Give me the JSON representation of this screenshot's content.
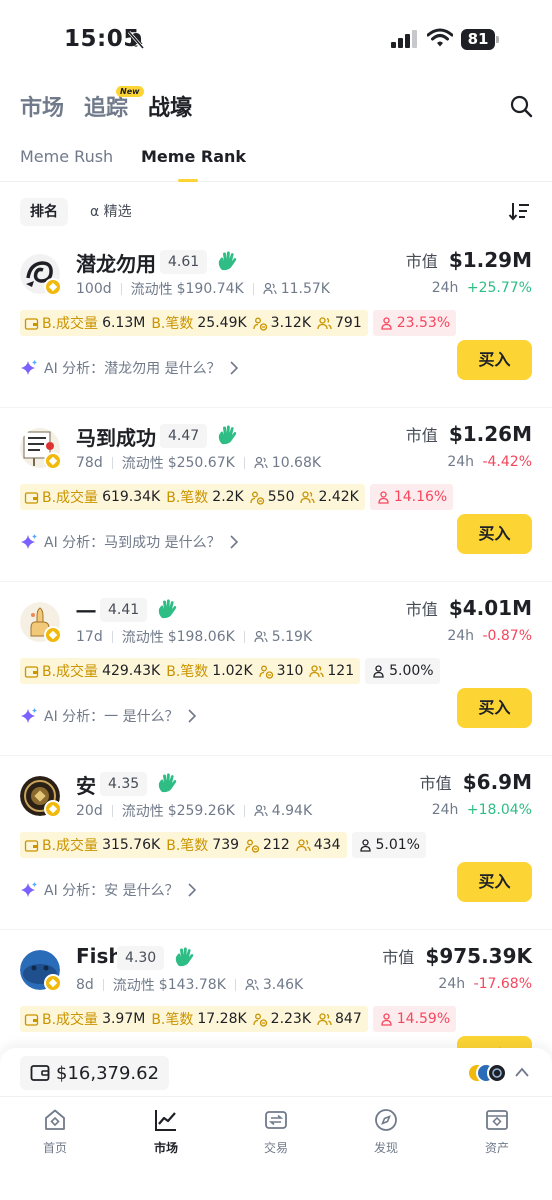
{
  "status_bar": {
    "time": "15:05",
    "battery": "81"
  },
  "top_tabs": [
    {
      "label": "市场",
      "active": false
    },
    {
      "label": "追踪",
      "active": false,
      "badge": "New"
    },
    {
      "label": "战壕",
      "active": true
    }
  ],
  "sub_tabs": [
    {
      "label": "Meme Rush",
      "active": false
    },
    {
      "label": "Meme Rank",
      "active": true
    }
  ],
  "filters": {
    "rank": "排名",
    "alpha": "α 精选"
  },
  "labels": {
    "market_cap": "市值",
    "change_period": "24h",
    "liquidity": "流动性",
    "b_volume": "B.成交量",
    "b_count": "B.笔数",
    "buy": "买入"
  },
  "tokens": [
    {
      "name": "潜龙勿用",
      "score": "4.61",
      "age": "100d",
      "liquidity": "$190.74K",
      "holders": "11.57K",
      "market_cap": "$1.29M",
      "change": "+25.77%",
      "direction": "up",
      "b_volume": "6.13M",
      "b_count": "25.49K",
      "stat3": "3.12K",
      "stat4": "791",
      "pct": "23.53%",
      "pct_style": "red",
      "ai": "AI 分析：潜龙勿用 是什么？"
    },
    {
      "name": "马到成功",
      "score": "4.47",
      "age": "78d",
      "liquidity": "$250.67K",
      "holders": "10.68K",
      "market_cap": "$1.26M",
      "change": "-4.42%",
      "direction": "down",
      "b_volume": "619.34K",
      "b_count": "2.2K",
      "stat3": "550",
      "stat4": "2.42K",
      "pct": "14.16%",
      "pct_style": "red",
      "ai": "AI 分析：马到成功 是什么？"
    },
    {
      "name": "一",
      "score": "4.41",
      "age": "17d",
      "liquidity": "$198.06K",
      "holders": "5.19K",
      "market_cap": "$4.01M",
      "change": "-0.87%",
      "direction": "down",
      "b_volume": "429.43K",
      "b_count": "1.02K",
      "stat3": "310",
      "stat4": "121",
      "pct": "5.00%",
      "pct_style": "gray",
      "ai": "AI 分析：一 是什么？"
    },
    {
      "name": "安",
      "score": "4.35",
      "age": "20d",
      "liquidity": "$259.26K",
      "holders": "4.94K",
      "market_cap": "$6.9M",
      "change": "+18.04%",
      "direction": "up",
      "b_volume": "315.76K",
      "b_count": "739",
      "stat3": "212",
      "stat4": "434",
      "pct": "5.01%",
      "pct_style": "gray",
      "ai": "AI 分析：安 是什么？"
    },
    {
      "name": "Fish",
      "score": "4.30",
      "age": "8d",
      "liquidity": "$143.78K",
      "holders": "3.46K",
      "market_cap": "$975.39K",
      "change": "-17.68%",
      "direction": "down",
      "b_volume": "3.97M",
      "b_count": "17.28K",
      "stat3": "2.23K",
      "stat4": "847",
      "pct": "14.59%",
      "pct_style": "red",
      "ai": ""
    }
  ],
  "wallet": {
    "balance": "$16,379.62"
  },
  "bottom_nav": [
    {
      "label": "首页",
      "icon": "home-icon",
      "active": false
    },
    {
      "label": "市场",
      "icon": "market-chart-icon",
      "active": true
    },
    {
      "label": "交易",
      "icon": "trade-icon",
      "active": false
    },
    {
      "label": "发现",
      "icon": "discover-icon",
      "active": false
    },
    {
      "label": "资产",
      "icon": "assets-icon",
      "active": false
    }
  ],
  "colors": {
    "accent": "#fcd535",
    "up": "#2ebd85",
    "down": "#f6465d",
    "stat_label": "#c99400"
  }
}
